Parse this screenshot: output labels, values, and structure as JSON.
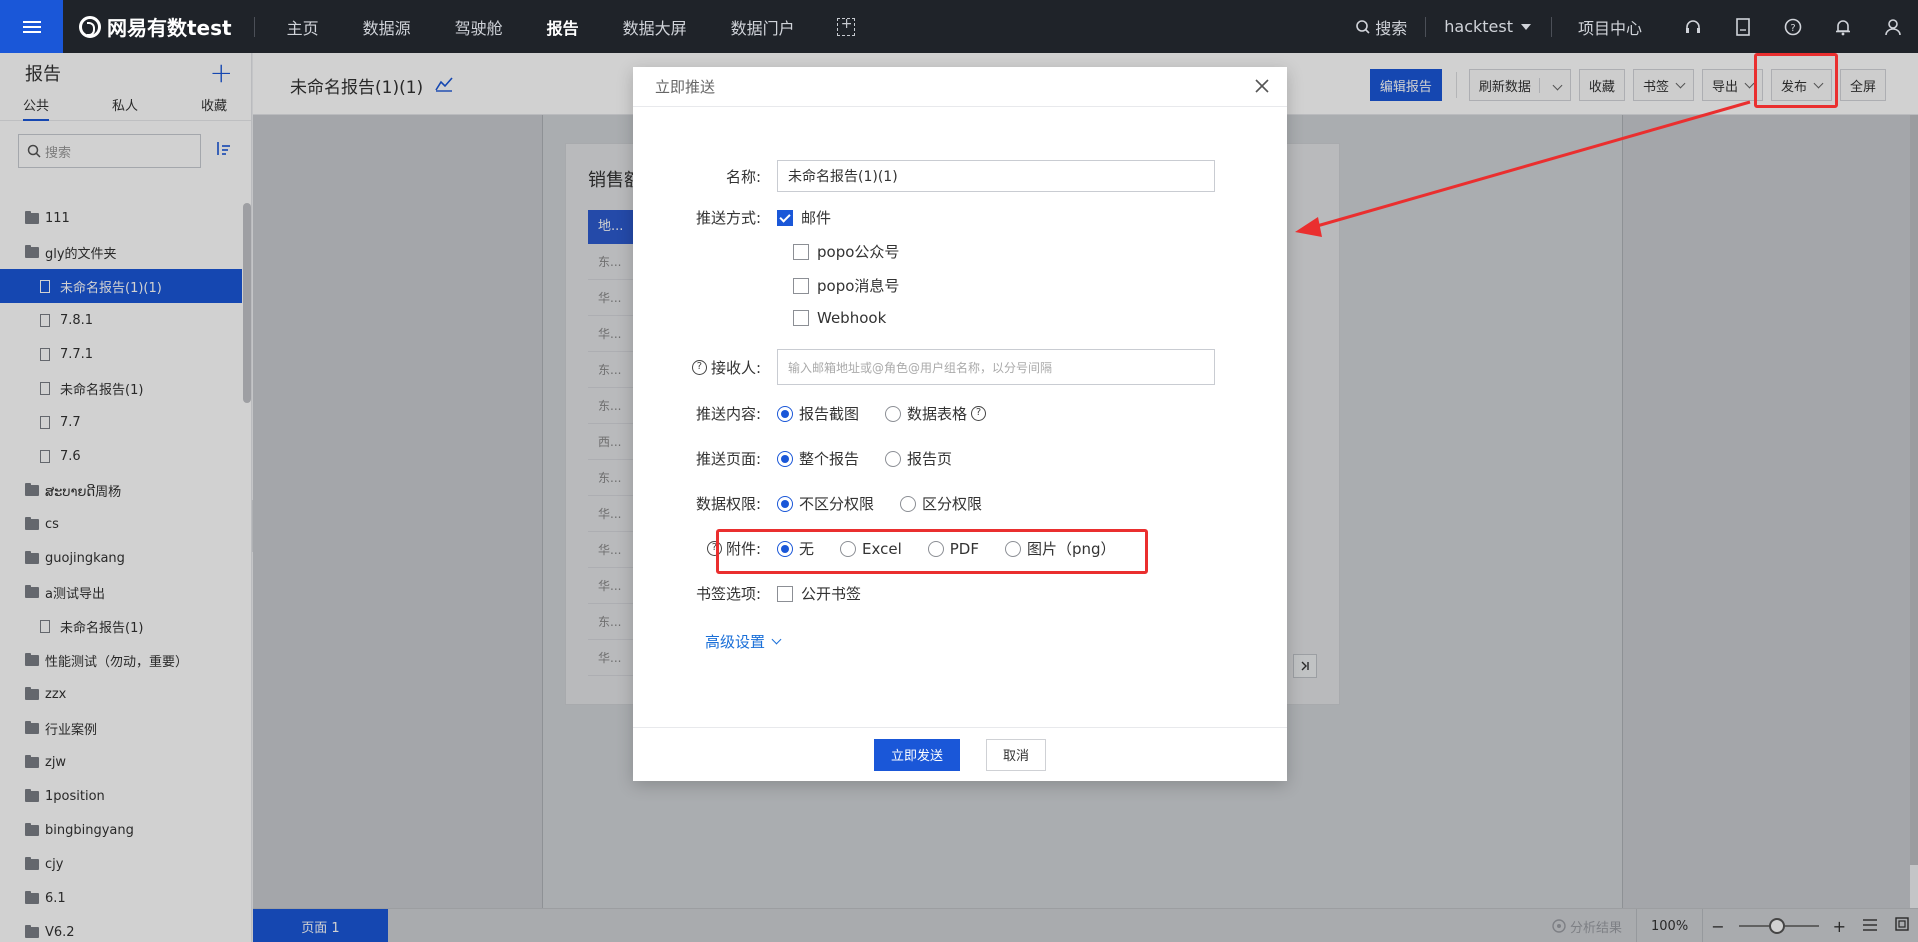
{
  "topnav": {
    "brand": "网易有数test",
    "items": [
      {
        "label": "主页",
        "active": false
      },
      {
        "label": "数据源",
        "active": false
      },
      {
        "label": "驾驶舱",
        "active": false
      },
      {
        "label": "报告",
        "active": true
      },
      {
        "label": "数据大屏",
        "active": false
      },
      {
        "label": "数据门户",
        "active": false
      }
    ],
    "search_label": "搜索",
    "user": "hacktest",
    "project_center": "项目中心"
  },
  "sidebar": {
    "title": "报告",
    "tabs": [
      "公共",
      "私人",
      "收藏"
    ],
    "search_placeholder": "搜索",
    "items": [
      {
        "label": "111",
        "type": "folder"
      },
      {
        "label": "gly的文件夹",
        "type": "folder"
      },
      {
        "label": "未命名报告(1)(1)",
        "type": "file",
        "active": true
      },
      {
        "label": "7.8.1",
        "type": "file"
      },
      {
        "label": "7.7.1",
        "type": "file"
      },
      {
        "label": "未命名报告(1)",
        "type": "file"
      },
      {
        "label": "7.7",
        "type": "file"
      },
      {
        "label": "7.6",
        "type": "file"
      },
      {
        "label": "ສະບາຍດີ周杨",
        "type": "folder"
      },
      {
        "label": "cs",
        "type": "folder"
      },
      {
        "label": "guojingkang",
        "type": "folder"
      },
      {
        "label": "a测试导出",
        "type": "folder"
      },
      {
        "label": "未命名报告(1)",
        "type": "file"
      },
      {
        "label": "性能测试（勿动，重要）",
        "type": "folder"
      },
      {
        "label": "zzx",
        "type": "folder"
      },
      {
        "label": "行业案例",
        "type": "folder"
      },
      {
        "label": "zjw",
        "type": "folder"
      },
      {
        "label": "1position",
        "type": "folder"
      },
      {
        "label": "bingbingyang",
        "type": "folder"
      },
      {
        "label": "cjy",
        "type": "folder"
      },
      {
        "label": "6.1",
        "type": "folder"
      },
      {
        "label": "V6.2",
        "type": "folder"
      }
    ]
  },
  "header": {
    "report_title": "未命名报告(1)(1)",
    "toolbar": {
      "edit": "编辑报告",
      "refresh": "刷新数据",
      "favorite": "收藏",
      "bookmark": "书签",
      "export": "导出",
      "publish": "发布",
      "fullscreen": "全屏"
    }
  },
  "widget": {
    "title": "销售额",
    "col_head": "地...",
    "rows": [
      "东...",
      "华...",
      "华...",
      "东...",
      "东...",
      "西...",
      "东...",
      "华...",
      "华...",
      "华...",
      "东...",
      "华..."
    ]
  },
  "bottombar": {
    "page_tab": "页面 1",
    "analysis": "分析结果",
    "zoom": "100%"
  },
  "dialog": {
    "title": "立即推送",
    "name_label": "名称:",
    "name_value": "未命名报告(1)(1)",
    "method_label": "推送方式:",
    "methods": [
      {
        "label": "邮件",
        "checked": true
      },
      {
        "label": "popo公众号",
        "checked": false
      },
      {
        "label": "popo消息号",
        "checked": false
      },
      {
        "label": "Webhook",
        "checked": false
      }
    ],
    "receiver_label": "接收人:",
    "receiver_placeholder": "输入邮箱地址或@角色@用户组名称，以分号间隔",
    "content_label": "推送内容:",
    "content_options": [
      "报告截图",
      "数据表格"
    ],
    "page_label": "推送页面:",
    "page_options": [
      "整个报告",
      "报告页"
    ],
    "perm_label": "数据权限:",
    "perm_options": [
      "不区分权限",
      "区分权限"
    ],
    "attach_label": "附件:",
    "attach_options": [
      "无",
      "Excel",
      "PDF",
      "图片（png）"
    ],
    "bookmark_label": "书签选项:",
    "bookmark_option": "公开书签",
    "advanced": "高级设置",
    "send": "立即发送",
    "cancel": "取消"
  },
  "colors": {
    "accent": "#1a57d8",
    "annotation_red": "#ea2f2f",
    "nav_bg": "#1f2329"
  }
}
